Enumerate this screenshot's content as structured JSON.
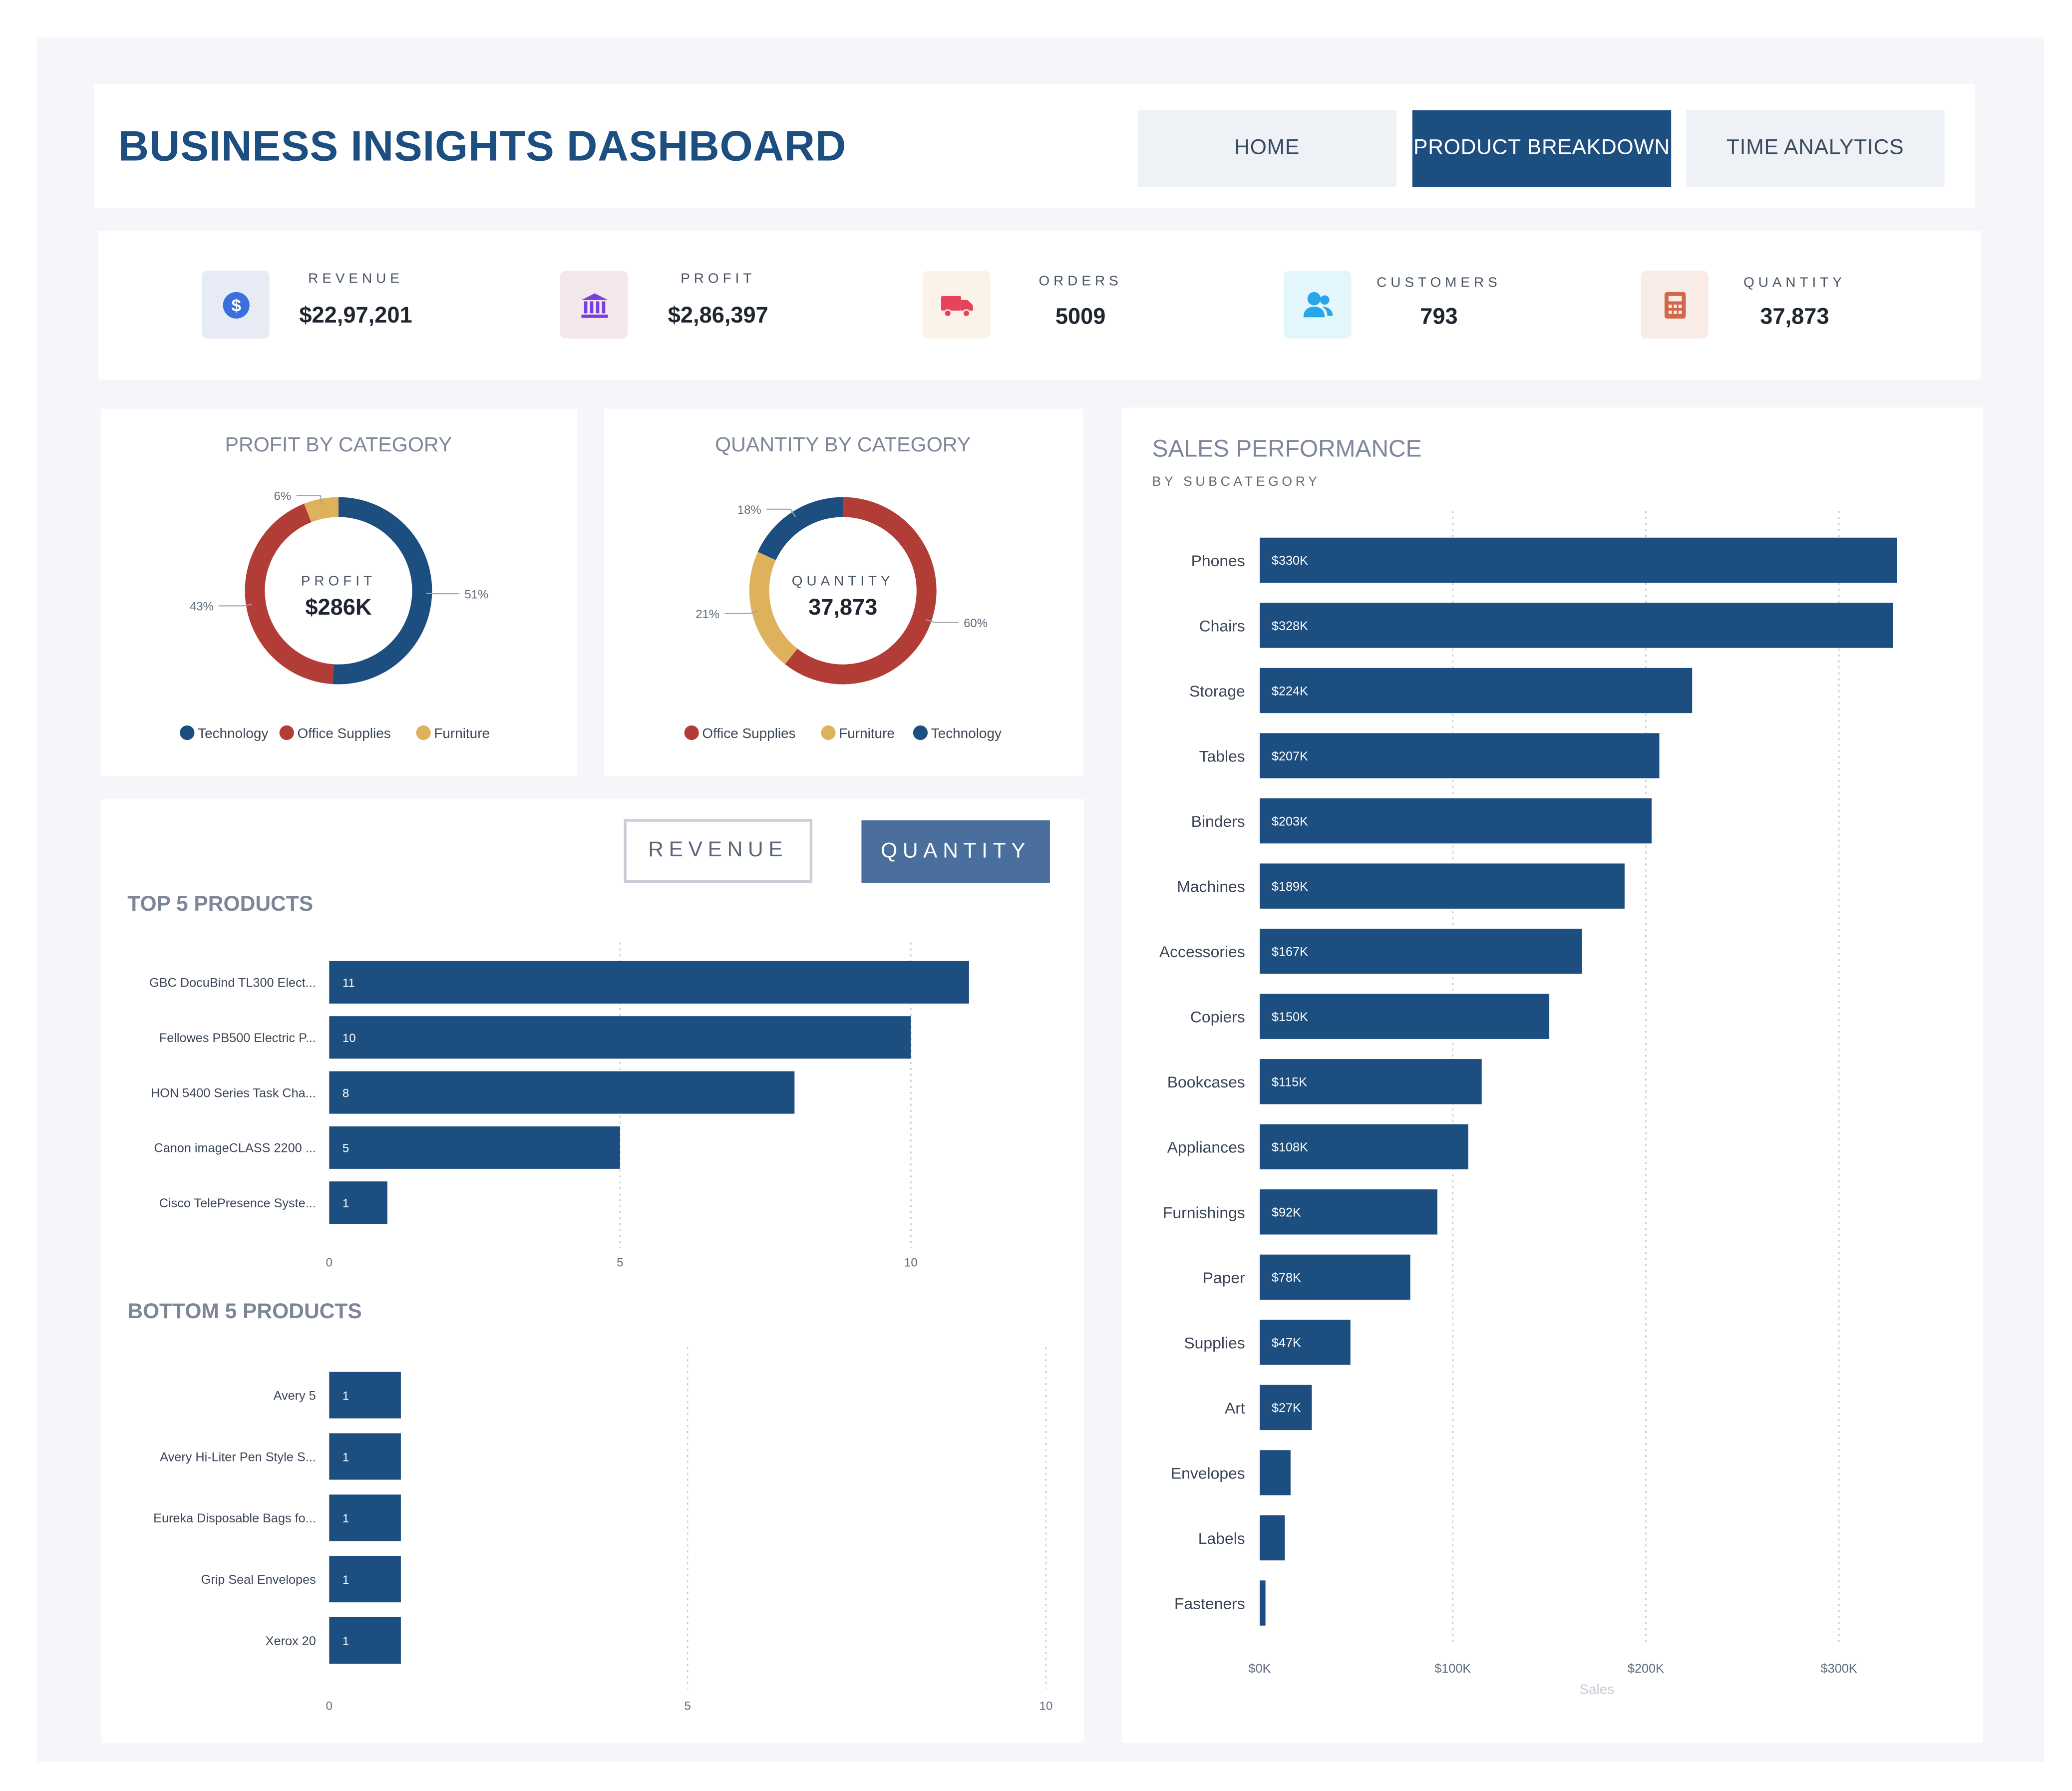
{
  "header": {
    "title": "BUSINESS INSIGHTS DASHBOARD",
    "nav": [
      {
        "label": "HOME",
        "active": false
      },
      {
        "label": "PRODUCT BREAKDOWN",
        "active": true
      },
      {
        "label": "TIME ANALYTICS",
        "active": false
      }
    ]
  },
  "kpis": [
    {
      "label": "REVENUE",
      "value": "$22,97,201",
      "icon": "dollar-icon",
      "color": "#3b6fe0",
      "bg": "#e6ebf5"
    },
    {
      "label": "PROFIT",
      "value": "$2,86,397",
      "icon": "bank-icon",
      "color": "#7a3fe0",
      "bg": "#f5e8ea"
    },
    {
      "label": "ORDERS",
      "value": "5009",
      "icon": "truck-icon",
      "color": "#e8435a",
      "bg": "#fbf3ea"
    },
    {
      "label": "CUSTOMERS",
      "value": "793",
      "icon": "users-icon",
      "color": "#29a6e6",
      "bg": "#e3f6fc"
    },
    {
      "label": "QUANTITY",
      "value": "37,873",
      "icon": "calculator-icon",
      "color": "#d2684a",
      "bg": "#f9ece6"
    }
  ],
  "colors": {
    "navy": "#1d4e80",
    "red": "#b23d36",
    "gold": "#deb25c",
    "toggle_active": "#4a6f9c"
  },
  "toggles": {
    "revenue": "REVENUE",
    "quantity": "QUANTITY",
    "active": "quantity"
  },
  "chart_data": [
    {
      "type": "pie",
      "title": "PROFIT BY CATEGORY",
      "center_label": "PROFIT",
      "center_value": "$286K",
      "slices": [
        {
          "name": "Technology",
          "value": 51,
          "label": "51%",
          "color": "#1d4e80"
        },
        {
          "name": "Office Supplies",
          "value": 43,
          "label": "43%",
          "color": "#b23d36"
        },
        {
          "name": "Furniture",
          "value": 6,
          "label": "6%",
          "color": "#deb25c"
        }
      ],
      "legend": [
        "Technology",
        "Office Supplies",
        "Furniture"
      ]
    },
    {
      "type": "pie",
      "title": "QUANTITY BY CATEGORY",
      "center_label": "QUANTITY",
      "center_value": "37,873",
      "slices": [
        {
          "name": "Office Supplies",
          "value": 60,
          "label": "60%",
          "color": "#b23d36"
        },
        {
          "name": "Furniture",
          "value": 21,
          "label": "21%",
          "color": "#deb25c"
        },
        {
          "name": "Technology",
          "value": 18,
          "label": "18%",
          "color": "#1d4e80"
        }
      ],
      "legend": [
        "Office Supplies",
        "Furniture",
        "Technology"
      ]
    },
    {
      "type": "bar",
      "title": "TOP 5 PRODUCTS",
      "categories": [
        "GBC DocuBind TL300 Elect...",
        "Fellowes PB500 Electric P...",
        "HON 5400 Series Task Cha...",
        "Canon imageCLASS 2200 ...",
        "Cisco TelePresence Syste..."
      ],
      "values": [
        11,
        10,
        8,
        5,
        1
      ],
      "data_labels": [
        "11",
        "10",
        "8",
        "5",
        "1"
      ],
      "xticks": [
        "0",
        "5",
        "10"
      ],
      "xlim": [
        0,
        12.3
      ]
    },
    {
      "type": "bar",
      "title": "BOTTOM 5 PRODUCTS",
      "categories": [
        "Avery 5",
        "Avery Hi-Liter Pen Style S...",
        "Eureka Disposable Bags fo...",
        "Grip Seal Envelopes",
        "Xerox 20"
      ],
      "values": [
        1,
        1,
        1,
        1,
        1
      ],
      "data_labels": [
        "1",
        "1",
        "1",
        "1",
        "1"
      ],
      "xticks": [
        "0",
        "5",
        "10"
      ],
      "xlim": [
        0,
        10
      ]
    },
    {
      "type": "bar",
      "title": "SALES PERFORMANCE",
      "subtitle": "BY SUBCATEGORY",
      "xlabel": "Sales",
      "categories": [
        "Phones",
        "Chairs",
        "Storage",
        "Tables",
        "Binders",
        "Machines",
        "Accessories",
        "Copiers",
        "Bookcases",
        "Appliances",
        "Furnishings",
        "Paper",
        "Supplies",
        "Art",
        "Envelopes",
        "Labels",
        "Fasteners"
      ],
      "values": [
        330,
        328,
        224,
        207,
        203,
        189,
        167,
        150,
        115,
        108,
        92,
        78,
        47,
        27,
        16,
        13,
        3
      ],
      "data_labels": [
        "$330K",
        "$328K",
        "$224K",
        "$207K",
        "$203K",
        "$189K",
        "$167K",
        "$150K",
        "$115K",
        "$108K",
        "$92K",
        "$78K",
        "$47K",
        "$27K",
        "",
        "",
        ""
      ],
      "xticks": [
        "$0K",
        "$100K",
        "$200K",
        "$300K"
      ],
      "xlim": [
        0,
        330
      ]
    }
  ]
}
